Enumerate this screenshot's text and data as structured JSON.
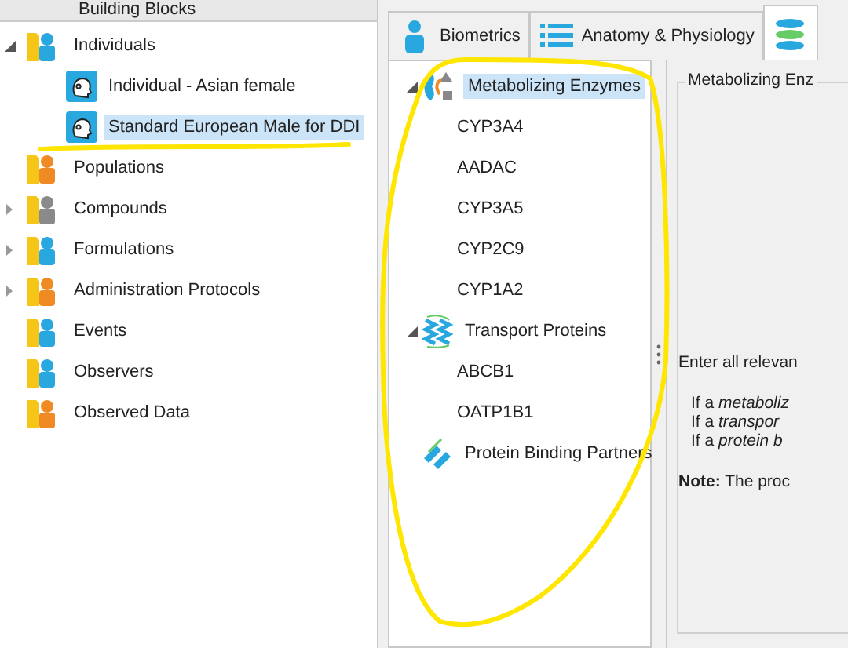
{
  "sidebar": {
    "title": "Building Blocks",
    "items": [
      {
        "label": "Individuals",
        "expanded": true,
        "selected": false,
        "children": [
          {
            "label": "Individual - Asian female",
            "selected": false
          },
          {
            "label": "Standard European Male for DDI",
            "selected": true
          }
        ]
      },
      {
        "label": "Populations",
        "selected": false
      },
      {
        "label": "Compounds",
        "expanded": false,
        "selected": false
      },
      {
        "label": "Formulations",
        "expanded": false,
        "selected": false
      },
      {
        "label": "Administration Protocols",
        "expanded": false,
        "selected": false
      },
      {
        "label": "Events",
        "selected": false
      },
      {
        "label": "Observers",
        "selected": false
      },
      {
        "label": "Observed Data",
        "selected": false
      }
    ]
  },
  "tabs": [
    {
      "label": "Biometrics",
      "selected": false
    },
    {
      "label": "Anatomy & Physiology",
      "selected": false
    },
    {
      "selected": true
    }
  ],
  "molecules": [
    {
      "label": "Metabolizing Enzymes",
      "expanded": true,
      "selected": true,
      "children": [
        {
          "label": "CYP3A4",
          "selected": false
        },
        {
          "label": "AADAC",
          "selected": false
        },
        {
          "label": "CYP3A5",
          "selected": false
        },
        {
          "label": "CYP2C9",
          "selected": false
        },
        {
          "label": "CYP1A2",
          "selected": false
        }
      ]
    },
    {
      "label": "Transport Proteins",
      "expanded": true,
      "selected": false,
      "children": [
        {
          "label": "ABCB1",
          "selected": false
        },
        {
          "label": "OATP1B1",
          "selected": false
        }
      ]
    },
    {
      "label": "Protein Binding Partners",
      "selected": false
    }
  ],
  "detail": {
    "group_title": "Metabolizing Enz",
    "intro": "Enter all relevan",
    "lines": [
      "If a *metaboliz*",
      "If a *transpor*",
      "If a *protein b*"
    ],
    "note": "**Note:** The proc"
  }
}
